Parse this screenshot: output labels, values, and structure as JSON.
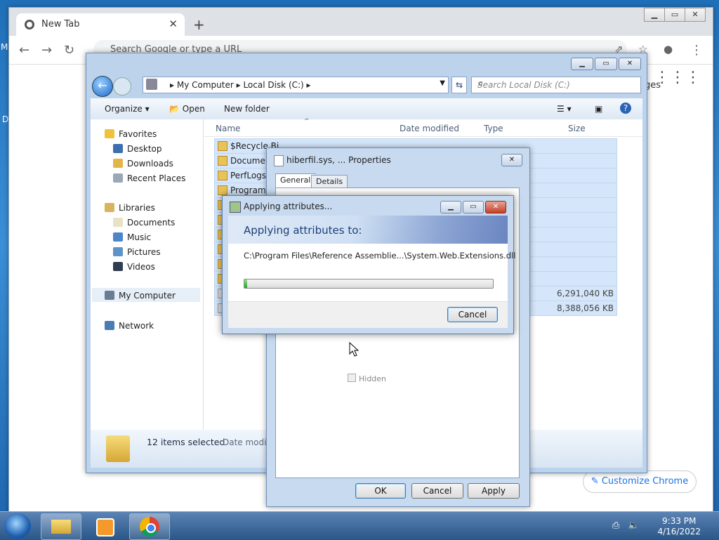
{
  "chrome": {
    "tab_title": "New Tab",
    "omnibox_placeholder": "Search Google or type a URL",
    "gmail_partial": "ges",
    "customize_label": "Customize Chrome"
  },
  "explorer": {
    "breadcrumb": [
      "My Computer",
      "Local Disk (C:)"
    ],
    "search_placeholder": "Search Local Disk (C:)",
    "commands": {
      "organize": "Organize",
      "open": "Open",
      "new_folder": "New folder"
    },
    "nav": {
      "favorites": "Favorites",
      "favorites_items": [
        "Desktop",
        "Downloads",
        "Recent Places"
      ],
      "libraries": "Libraries",
      "libraries_items": [
        "Documents",
        "Music",
        "Pictures",
        "Videos"
      ],
      "computer": "My Computer",
      "network": "Network"
    },
    "columns": {
      "name": "Name",
      "date": "Date modified",
      "type": "Type",
      "size": "Size"
    },
    "rows": [
      {
        "name": "$Recycle.Bi",
        "size": ""
      },
      {
        "name": "Documen",
        "size": ""
      },
      {
        "name": "PerfLogs",
        "size": ""
      },
      {
        "name": "Program",
        "size": ""
      },
      {
        "name": "",
        "size": "6,291,040 KB"
      },
      {
        "name": "",
        "size": "8,388,056 KB"
      }
    ],
    "status": {
      "selected": "12 items selected",
      "date_label": "Date modifi"
    }
  },
  "properties": {
    "title": "hiberfil.sys, ... Properties",
    "tabs": [
      "General",
      "Details"
    ],
    "hidden_label": "Hidden",
    "buttons": {
      "ok": "OK",
      "cancel": "Cancel",
      "apply": "Apply"
    }
  },
  "apply_dialog": {
    "title": "Applying attributes...",
    "heading": "Applying attributes to:",
    "path": "C:\\Program Files\\Reference Assemblie...\\System.Web.Extensions.dll",
    "progress": 0.01,
    "cancel": "Cancel"
  },
  "taskbar": {
    "time": "9:33 PM",
    "date": "4/16/2022"
  },
  "desktop_edge": {
    "top_letter": "M",
    "mid_letter": "D"
  }
}
